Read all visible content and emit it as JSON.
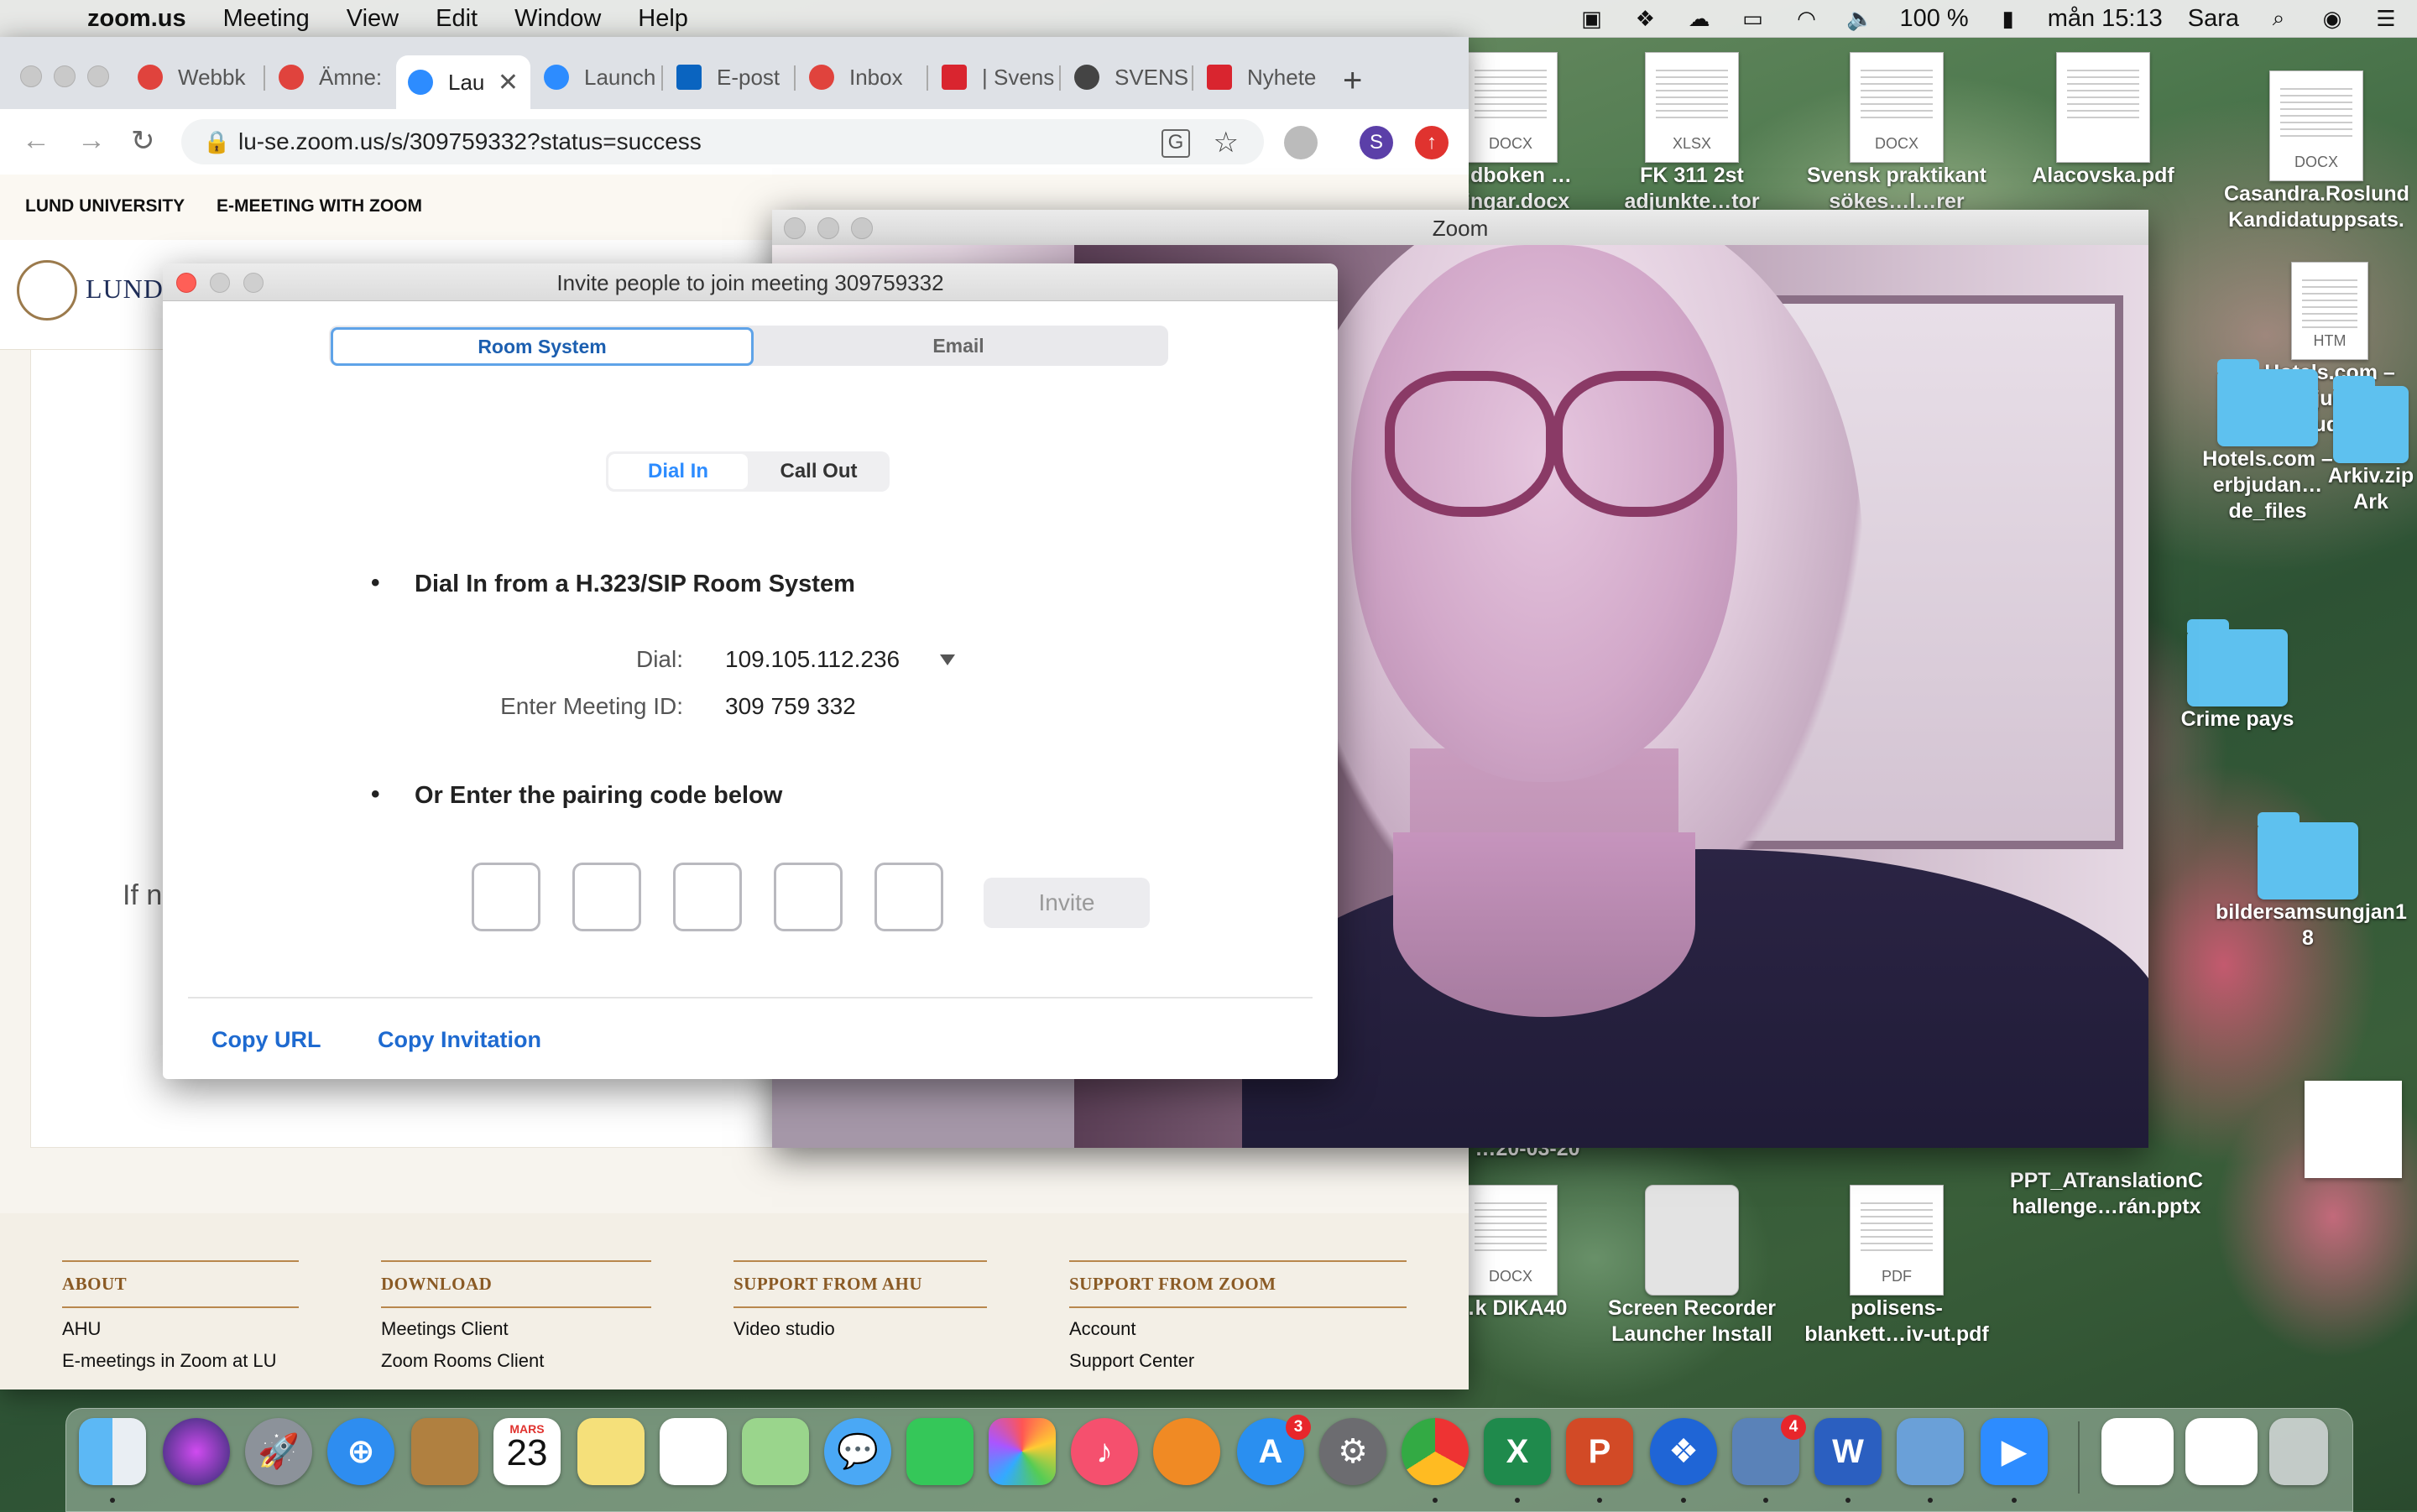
{
  "menubar": {
    "app": "zoom.us",
    "items": [
      "Meeting",
      "View",
      "Edit",
      "Window",
      "Help"
    ],
    "battery": "100 %",
    "clock": "mån 15:13",
    "user": "Sara"
  },
  "desktop": {
    "icons": [
      {
        "label": "…dboken …ningar.docx",
        "tag": "DOCX",
        "kind": "doc"
      },
      {
        "label": "FK 311 2st adjunkte…tor HT20",
        "tag": "XLSX",
        "kind": "doc"
      },
      {
        "label": "Svensk praktikant sökes…l…rer 2020",
        "tag": "DOCX",
        "kind": "doc"
      },
      {
        "label": "Alacovska.pdf",
        "tag": "",
        "kind": "doc"
      },
      {
        "label": "Casandra.Roslund Kandidatuppsats.",
        "tag": "DOCX",
        "kind": "doc"
      },
      {
        "label": "Hotels.com – erbjuda…erbjudan…",
        "tag": "HTM",
        "kind": "doc"
      },
      {
        "label": "Hotels.com – erbjudan…de_files",
        "tag": "",
        "kind": "folder"
      },
      {
        "label": "Arkiv.zip Ark",
        "tag": "",
        "kind": "folder"
      },
      {
        "label": "Crime pays",
        "tag": "",
        "kind": "folder"
      },
      {
        "label": "bildersamsungjan1 8",
        "tag": "",
        "kind": "folder"
      },
      {
        "label": "PPT_ATranslationC hallenge…rán.pptx",
        "tag": "",
        "kind": "doc"
      },
      {
        "label": "…k DIKA40",
        "tag": "DOCX",
        "kind": "doc"
      },
      {
        "label": "Screen Recorder Launcher Install",
        "tag": "",
        "kind": "disk"
      },
      {
        "label": "polisens- blankett…iv-ut.pdf",
        "tag": "PDF",
        "kind": "doc"
      },
      {
        "label": "…20-03-20",
        "tag": "",
        "kind": "text"
      }
    ]
  },
  "browser": {
    "tabs": [
      {
        "label": "Webbk",
        "color": "#e0433d"
      },
      {
        "label": "Ämne:",
        "color": "#e0433d"
      },
      {
        "label": "Lau",
        "color": "#2d8cff",
        "active": true
      },
      {
        "label": "Launch",
        "color": "#2d8cff"
      },
      {
        "label": "E-post",
        "color": "#0a64c0"
      },
      {
        "label": "Inbox",
        "color": "#e0433d"
      },
      {
        "label": "| Svens",
        "color": "#d9252f"
      },
      {
        "label": "SVENS",
        "color": "#444444"
      },
      {
        "label": "Nyhete",
        "color": "#d9252f"
      }
    ],
    "new_tab": "+",
    "url": "lu-se.zoom.us/s/309759332?status=success",
    "profile_initial": "S"
  },
  "page": {
    "top_links": [
      "LUND UNIVERSITY",
      "E-MEETING WITH ZOOM"
    ],
    "brand_name": "LUND U",
    "partial_text": "If n",
    "footer": [
      {
        "heading": "ABOUT",
        "links": [
          "AHU",
          "E-meetings in Zoom at LU"
        ]
      },
      {
        "heading": "DOWNLOAD",
        "links": [
          "Meetings Client",
          "Zoom Rooms Client"
        ]
      },
      {
        "heading": "SUPPORT FROM AHU",
        "links": [
          "Video studio"
        ]
      },
      {
        "heading": "SUPPORT FROM ZOOM",
        "links": [
          "Account",
          "Support Center"
        ]
      }
    ]
  },
  "zoom_window": {
    "title": "Zoom"
  },
  "dialog": {
    "title": "Invite people to join meeting 309759332",
    "tabs": [
      "Room System",
      "Email"
    ],
    "dial_tabs": [
      "Dial In",
      "Call Out"
    ],
    "section1": "Dial In from a H.323/SIP Room System",
    "dial_label": "Dial:",
    "dial_value": "109.105.112.236",
    "meeting_id_label": "Enter Meeting ID:",
    "meeting_id_value": "309 759 332",
    "section2": "Or Enter the pairing code below",
    "invite_button": "Invite",
    "copy_url": "Copy URL",
    "copy_invitation": "Copy Invitation"
  },
  "dock": {
    "calendar_month": "MARS",
    "calendar_day": "23",
    "badges": {
      "app_store": "3",
      "mail": "4"
    }
  }
}
